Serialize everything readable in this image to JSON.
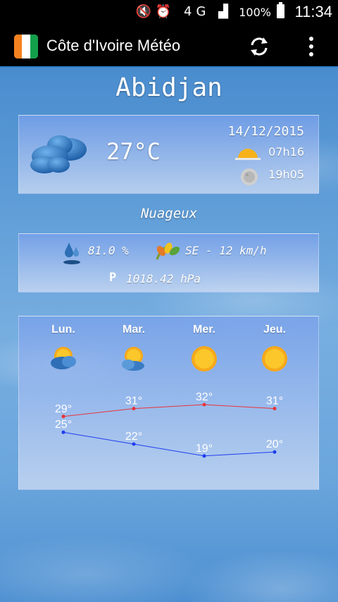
{
  "status_bar": {
    "battery": "100%",
    "time": "11:34"
  },
  "app_bar": {
    "title": "Côte d'Ivoire Météo"
  },
  "city": "Abidjan",
  "current": {
    "temperature": "27°C",
    "date": "14/12/2015",
    "sunrise": "07h16",
    "sunset": "19h05",
    "condition": "Nuageux"
  },
  "details": {
    "humidity": "81.0 %",
    "wind": "SE - 12 km/h",
    "pressure_label": "P",
    "pressure": "1018.42 hPa"
  },
  "forecast": {
    "days": [
      "Lun.",
      "Mar.",
      "Mer.",
      "Jeu."
    ],
    "icons": [
      "partly-cloudy-icon",
      "partly-cloudy-icon",
      "sun-icon",
      "sun-icon"
    ],
    "colors": {
      "high": "#e8343a",
      "low": "#1f3cf0"
    }
  },
  "chart_data": {
    "type": "line",
    "categories": [
      "Lun.",
      "Mar.",
      "Mer.",
      "Jeu."
    ],
    "series": [
      {
        "values": [
          29,
          31,
          32,
          31
        ],
        "labels": [
          "29°",
          "31°",
          "32°",
          "31°"
        ]
      },
      {
        "values": [
          25,
          22,
          19,
          20
        ],
        "labels": [
          "25°",
          "22°",
          "19°",
          "20°"
        ]
      }
    ]
  }
}
